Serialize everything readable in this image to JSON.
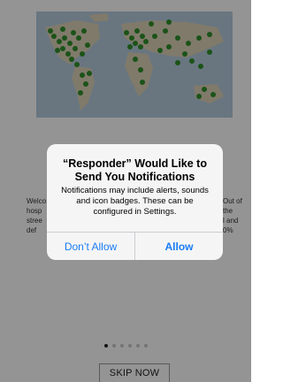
{
  "background": {
    "left_text": "Welco\nhosp\nstree\ndef",
    "right_text": "Out of\nthe\nl and\n0%"
  },
  "pagination": {
    "total": 6,
    "active": 0
  },
  "skip_button": {
    "label": "SKIP NOW"
  },
  "alert": {
    "title": "“Responder” Would Like to Send You Notifications",
    "message": "Notifications may include alerts, sounds and icon badges. These can be configured in Settings.",
    "deny_label": "Don’t Allow",
    "allow_label": "Allow",
    "button_color": "#1a7cf4"
  },
  "icons": {
    "map_markers": "airplane-icon"
  }
}
